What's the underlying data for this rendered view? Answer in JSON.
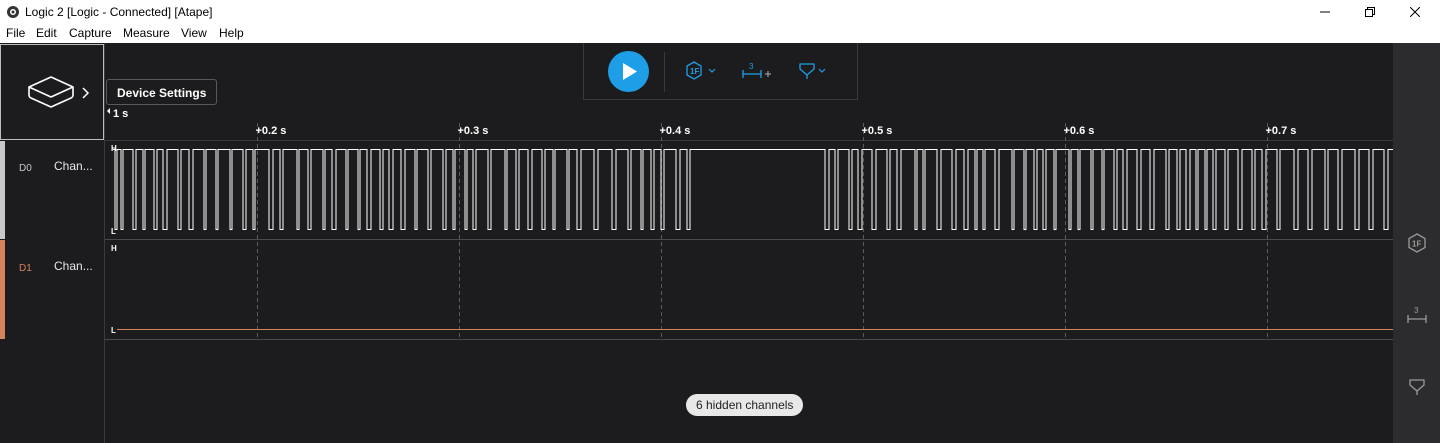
{
  "window": {
    "title": "Logic 2 [Logic - Connected] [Atape]"
  },
  "menu": [
    "File",
    "Edit",
    "Capture",
    "Measure",
    "View",
    "Help"
  ],
  "device": {
    "tooltip": "Device Settings"
  },
  "timeline": {
    "start_label": "1 s",
    "ticks": [
      "+0.2 s",
      "+0.3 s",
      "+0.4 s",
      "+0.5 s",
      "+0.6 s",
      "+0.7 s"
    ]
  },
  "channels": [
    {
      "id": "D0",
      "name": "Chan...",
      "color": "#c8c8c8",
      "high_label": "H",
      "low_label": "L"
    },
    {
      "id": "D1",
      "name": "Chan...",
      "color": "#d4845c",
      "high_label": "H",
      "low_label": "L"
    }
  ],
  "hidden_channels": "6 hidden channels",
  "toolbar": {
    "play": "play-icon",
    "trigger": "trigger-icon",
    "measure": "measure-icon",
    "marker": "marker-icon"
  },
  "colors": {
    "accent": "#1e9ee6",
    "background": "#1c1c1e",
    "sidebar": "#2c2c2e",
    "d0": "#c8c8c8",
    "d1": "#d4845c"
  }
}
